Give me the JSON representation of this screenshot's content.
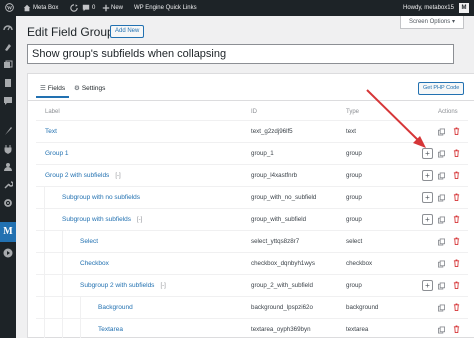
{
  "colors": {
    "adminbar": "#1d2327",
    "accent": "#2271b1",
    "arrow": "#d63638"
  },
  "adminbar": {
    "site": "Meta Box",
    "comments": "0",
    "new_label": "New",
    "plugin_link": "WP Engine Quick Links",
    "howdy": "Howdy, metabox15",
    "avatar_letter": "M"
  },
  "sidebar_icons": [
    "dashboard-icon",
    "posts-icon",
    "media-icon",
    "pages-icon",
    "comments-icon",
    "appearance-icon",
    "plugins-icon",
    "users-icon",
    "tools-icon",
    "settings-icon",
    "metabox-icon",
    "play-icon"
  ],
  "sidebar_metabox_letter": "M",
  "screen_options": "Screen Options ▾",
  "page_title": "Edit Field Group",
  "add_new": "Add New",
  "title_value": "Show group's subfields when collapsing",
  "tabs": {
    "fields": "Fields",
    "settings": "Settings"
  },
  "get_php_code": "Get PHP Code",
  "headers": {
    "label": "Label",
    "id": "ID",
    "type": "Type",
    "actions": "Actions"
  },
  "rows": [
    {
      "label": "Text",
      "id": "text_g2zdj96lf5",
      "type": "text",
      "toggle": ""
    },
    {
      "label": "Group 1",
      "id": "group_1",
      "type": "group",
      "toggle": ""
    },
    {
      "label": "Group 2 with subfields",
      "id": "group_l4xastfnrb",
      "type": "group",
      "toggle": "[-]"
    },
    {
      "label": "Subgroup with no subfields",
      "id": "group_with_no_subfield",
      "type": "group",
      "toggle": ""
    },
    {
      "label": "Subgroup with subfields",
      "id": "group_with_subfield",
      "type": "group",
      "toggle": "[-]"
    },
    {
      "label": "Select",
      "id": "select_yttqs8z8r7",
      "type": "select",
      "toggle": ""
    },
    {
      "label": "Checkbox",
      "id": "checkbox_dqnbyh1wys",
      "type": "checkbox",
      "toggle": ""
    },
    {
      "label": "Subgroup 2 with subfields",
      "id": "group_2_with_subfield",
      "type": "group",
      "toggle": "[-]"
    },
    {
      "label": "Background",
      "id": "background_lpspzi62o",
      "type": "background",
      "toggle": ""
    },
    {
      "label": "Textarea",
      "id": "textarea_oyph369byn",
      "type": "textarea",
      "toggle": ""
    }
  ],
  "add_icon_glyph": "+"
}
